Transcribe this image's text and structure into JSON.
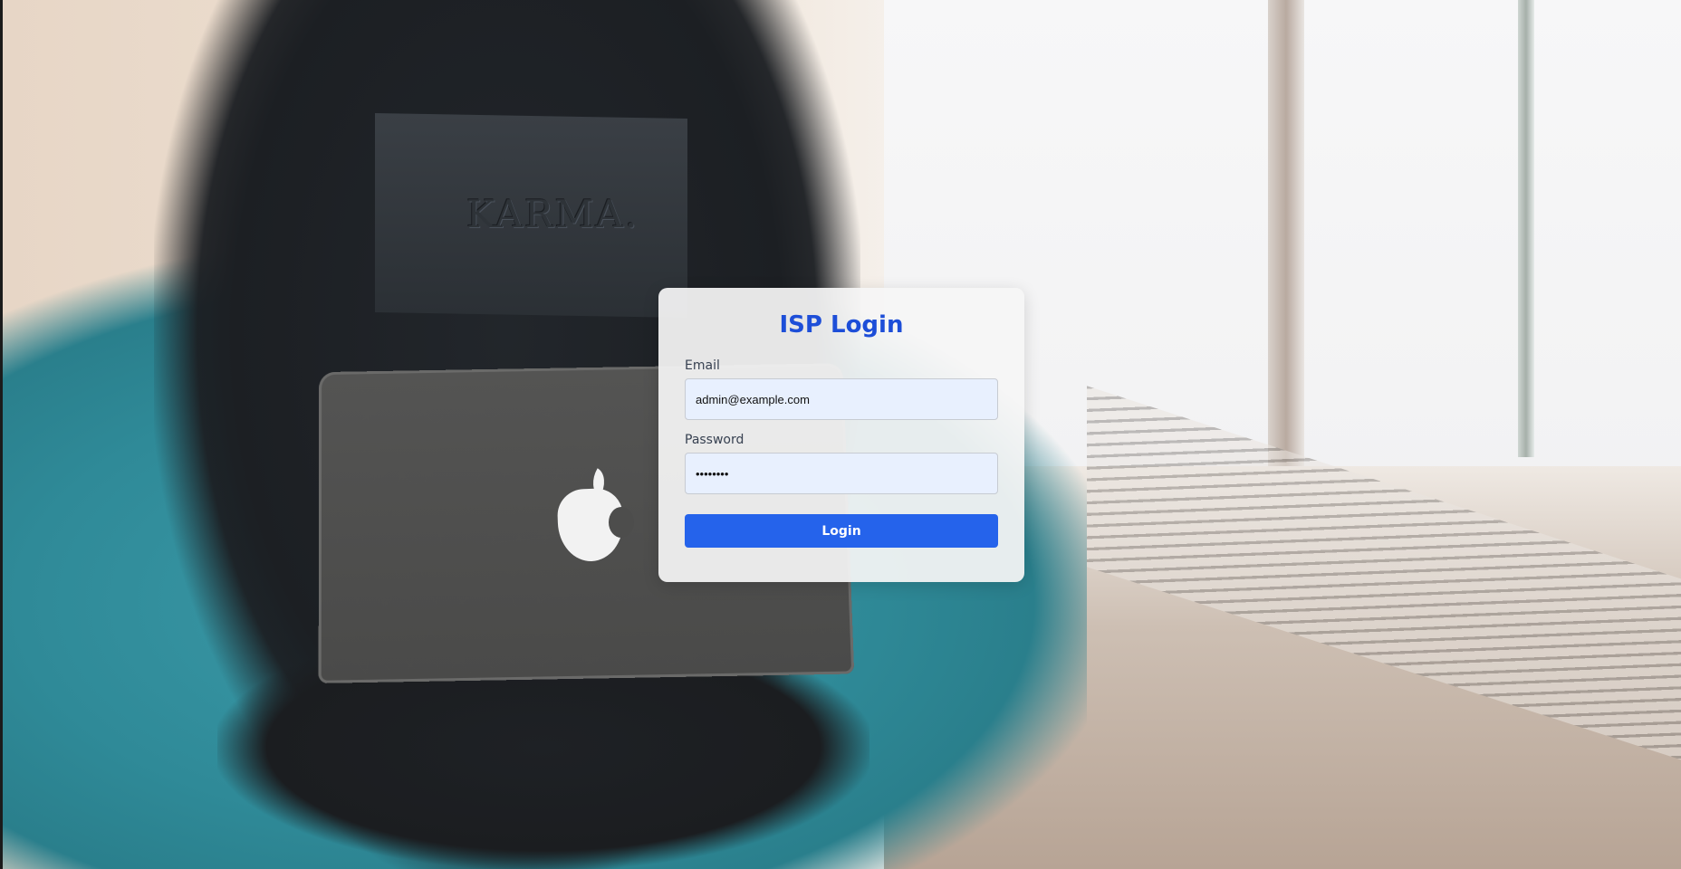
{
  "login": {
    "title": "ISP Login",
    "email_label": "Email",
    "email_value": "admin@example.com",
    "password_label": "Password",
    "password_value": "password",
    "submit_label": "Login"
  },
  "background": {
    "shirt_text": "KARMA."
  },
  "colors": {
    "title": "#1d4ed8",
    "button": "#2563eb",
    "input_bg": "#e8f0fe"
  }
}
